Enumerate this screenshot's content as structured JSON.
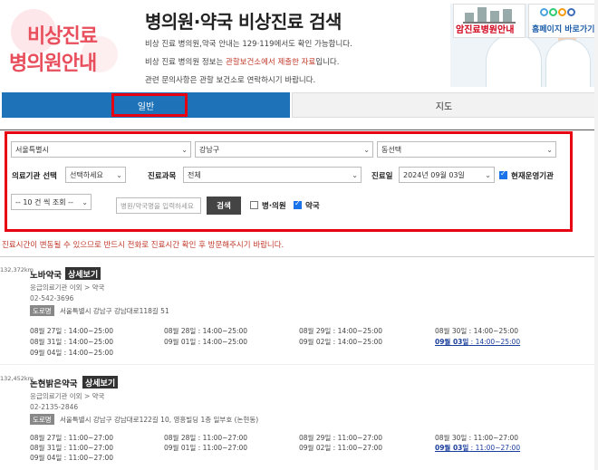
{
  "header": {
    "logo_line1": "비상진료",
    "logo_line2": "병의원안내",
    "title": "병의원·약국 비상진료 검색",
    "desc1": "비상 진료 병의원,약국 안내는 129·119에서도 확인 가능합니다.",
    "desc2_pre": "비상 진료 병의원 정보는 ",
    "desc2_hl": "관할보건소에서 제출한 자료",
    "desc2_post": "입니다.",
    "desc3": "관련 문의사항은 관할 보건소로 연락하시기 바랍니다.",
    "btn_cancer": "암진료병원안내",
    "btn_home": "홈페이지 바로가기"
  },
  "tabs": [
    {
      "label": "일반",
      "active": true
    },
    {
      "label": "지도",
      "active": false
    }
  ],
  "search": {
    "city": "서울특별시",
    "district": "강남구",
    "dong": "동선택",
    "inst_label": "의료기관 선택",
    "inst_value": "선택하세요",
    "dept_label": "진료과목",
    "dept_value": "전체",
    "date_label": "진료일",
    "date_value": "2024년 09월 03일",
    "open_now_label": "현재운영기관",
    "page_size": "-- 10 건 씩 조회 --",
    "name_placeholder": "병원/약국명을 입력하세요",
    "search_button": "검색",
    "clinic_label": "병·의원",
    "pharmacy_label": "약국"
  },
  "notice": "진료시간이 변동될 수 있으므로 반드시 전화로 진료시간 확인 후 방문해주시기 바랍니다.",
  "results": [
    {
      "distance": "132,372km",
      "name": "노바약국",
      "detail": "상세보기",
      "type": "응급의료기관 이외 > 약국",
      "phone": "02-542-3696",
      "addr_badge": "도로명",
      "address": "서울특별시 강남구 강남대로118길 51",
      "hours": [
        "08월 27일 : 14:00~25:00",
        "08월 28일 : 14:00~25:00",
        "08월 29일 : 14:00~25:00",
        "08월 30일 : 14:00~25:00",
        "08월 31일 : 14:00~25:00",
        "09월 01일 : 14:00~25:00",
        "09월 02일 : 14:00~25:00",
        "09월 04일 : 14:00~25:00"
      ],
      "today_date": "09월 03일",
      "today_time": " : 14:00~25:00"
    },
    {
      "distance": "132,452km",
      "name": "논현밝은약국",
      "detail": "상세보기",
      "type": "응급의료기관 이외 > 약국",
      "phone": "02-2135-2846",
      "addr_badge": "도로명",
      "address": "서울특별시 강남구 강남대로122길 10, 영흥빌딩 1층 일부호 (논현동)",
      "hours": [
        "08월 27일 : 11:00~27:00",
        "08월 28일 : 11:00~27:00",
        "08월 29일 : 11:00~27:00",
        "08월 30일 : 11:00~27:00",
        "08월 31일 : 11:00~27:00",
        "09월 01일 : 11:00~27:00",
        "09월 02일 : 11:00~27:00",
        "09월 04일 : 11:00~27:00"
      ],
      "today_date": "09월 03일",
      "today_time": " : 11:00~27:00"
    }
  ]
}
